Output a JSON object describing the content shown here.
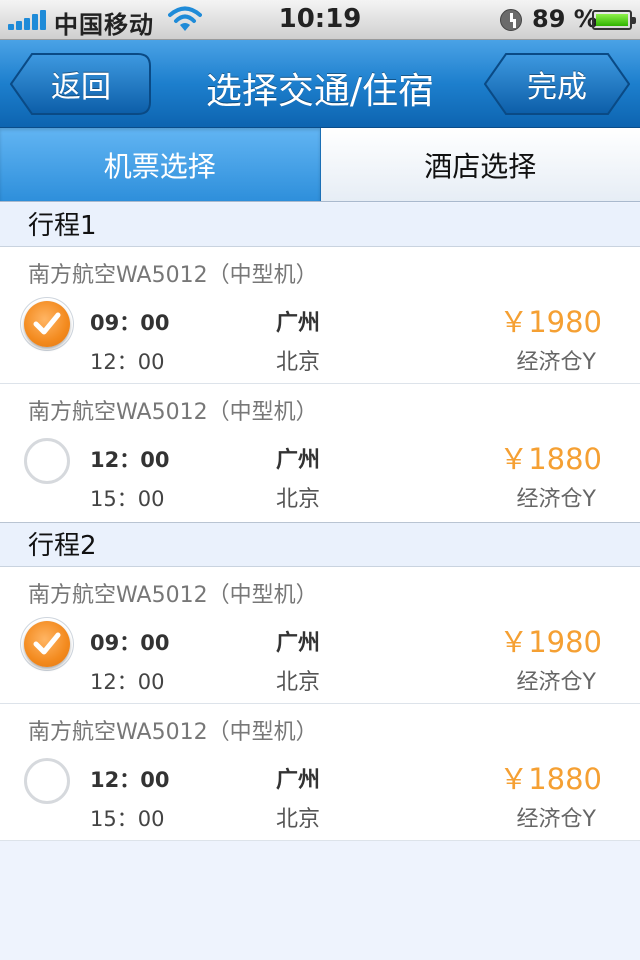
{
  "status_bar": {
    "carrier": "中国移动",
    "time": "10:19",
    "battery": "89 %"
  },
  "nav": {
    "back_label": "返回",
    "title": "选择交通/住宿",
    "done_label": "完成"
  },
  "tabs": [
    {
      "label": "机票选择",
      "active": true
    },
    {
      "label": "酒店选择",
      "active": false
    }
  ],
  "sections": [
    {
      "title": "行程1",
      "flights": [
        {
          "airline": "南方航空WA5012（中型机）",
          "selected": true,
          "dep_time": "09：00",
          "arr_time": "12：00",
          "dep_city": "广州",
          "arr_city": "北京",
          "price": "￥1980",
          "cabin": "经济仓Y"
        },
        {
          "airline": "南方航空WA5012（中型机）",
          "selected": false,
          "dep_time": "12：00",
          "arr_time": "15：00",
          "dep_city": "广州",
          "arr_city": "北京",
          "price": "￥1880",
          "cabin": "经济仓Y"
        }
      ]
    },
    {
      "title": "行程2",
      "flights": [
        {
          "airline": "南方航空WA5012（中型机）",
          "selected": true,
          "dep_time": "09：00",
          "arr_time": "12：00",
          "dep_city": "广州",
          "arr_city": "北京",
          "price": "￥1980",
          "cabin": "经济仓Y"
        },
        {
          "airline": "南方航空WA5012（中型机）",
          "selected": false,
          "dep_time": "12：00",
          "arr_time": "15：00",
          "dep_city": "广州",
          "arr_city": "北京",
          "price": "￥1880",
          "cabin": "经济仓Y"
        }
      ]
    }
  ],
  "colors": {
    "nav_blue": "#1d7fcd",
    "price_orange": "#f5a033",
    "selected_orange": "#f38a1e"
  }
}
